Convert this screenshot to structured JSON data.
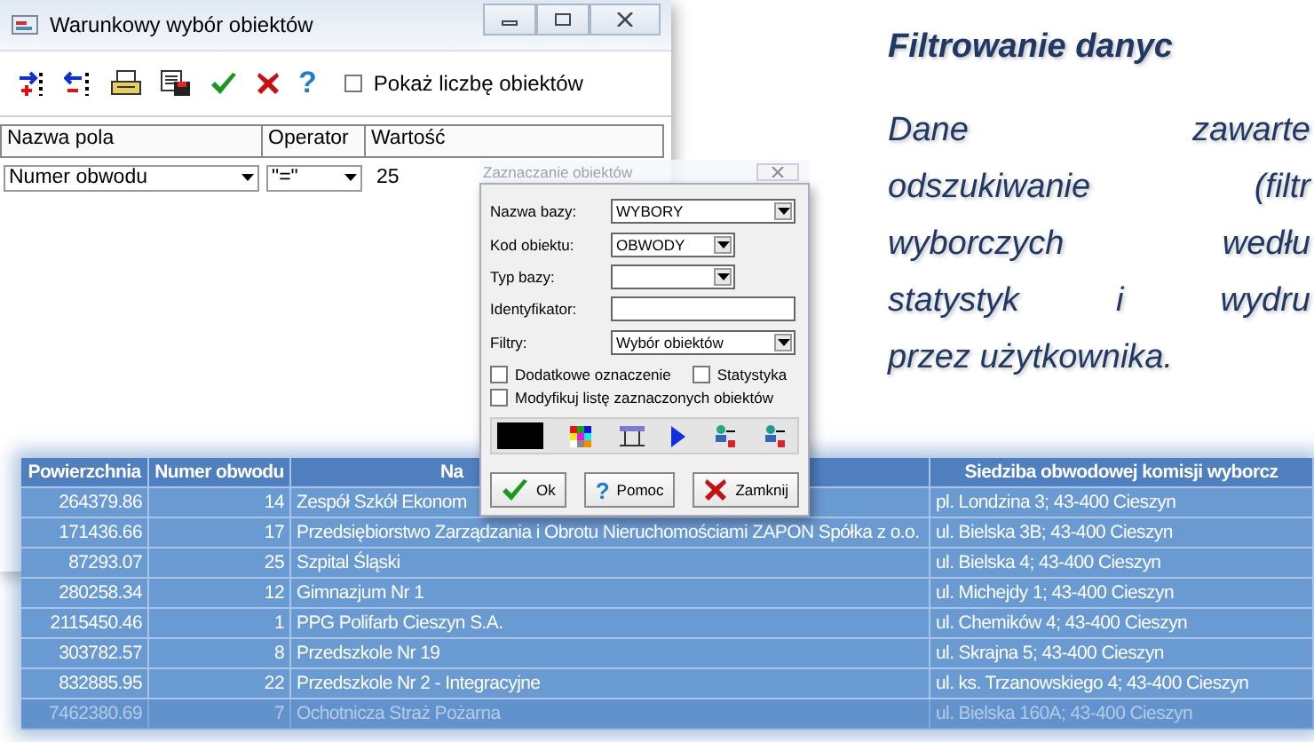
{
  "filter_window": {
    "title": "Warunkowy wybór obiektów",
    "help_glyph": "?",
    "show_count": {
      "label": "Pokaż liczbę obiektów",
      "checked": false
    },
    "columns": [
      "Nazwa pola",
      "Operator",
      "Wartość"
    ],
    "condition": {
      "field": "Numer obwodu",
      "operator": "\"=\"",
      "value": "25"
    }
  },
  "select_dialog": {
    "title": "Zaznaczanie obiektów",
    "fields": [
      {
        "label": "Nazwa bazy:",
        "kind": "select",
        "value": "WYBORY"
      },
      {
        "label": "Kod obiektu:",
        "kind": "select",
        "value": "OBWODY"
      },
      {
        "label": "Typ bazy:",
        "kind": "select"
      },
      {
        "label": "Identyfikator:",
        "kind": "input"
      },
      {
        "label": "Filtry:",
        "kind": "select",
        "value": "Wybór obiektów"
      }
    ],
    "checkboxes": [
      {
        "label": "Dodatkowe oznaczenie",
        "checked": false
      },
      {
        "label": "Statystyka",
        "checked": false
      },
      {
        "label": "Modyfikuj listę zaznaczonych obiektów",
        "checked": false
      }
    ],
    "buttons": [
      {
        "label": "Ok",
        "kind": "ok"
      },
      {
        "label": "Pomoc",
        "kind": "help",
        "glyph": "?"
      },
      {
        "label": "Zamknij",
        "kind": "close"
      }
    ]
  },
  "results_table": {
    "columns": [
      "Powierzchnia",
      "Numer obwodu",
      "Na",
      "Siedziba obwodowej komisji wyborcz"
    ],
    "rows": [
      [
        "264379.86",
        "14",
        "Zespół Szkół Ekonom",
        "pl. Londzina 3; 43-400 Cieszyn"
      ],
      [
        "171436.66",
        "17",
        "Przedsiębiorstwo Zarządzania i Obrotu Nieruchomościami ZAPON Spółka z o.o.",
        "ul. Bielska 3B; 43-400 Cieszyn"
      ],
      [
        "87293.07",
        "25",
        "Szpital Śląski",
        "ul. Bielska 4; 43-400 Cieszyn"
      ],
      [
        "280258.34",
        "12",
        "Gimnazjum Nr 1",
        "ul. Michejdy 1; 43-400 Cieszyn"
      ],
      [
        "2115450.46",
        "1",
        "PPG Polifarb Cieszyn S.A.",
        "ul. Chemików 4; 43-400 Cieszyn"
      ],
      [
        "303782.57",
        "8",
        "Przedszkole Nr 19",
        "ul. Skrajna 5; 43-400 Cieszyn"
      ],
      [
        "832885.95",
        "22",
        "Przedszkole Nr 2 - Integracyjne",
        "ul. ks. Trzanowskiego 4; 43-400 Cieszyn"
      ],
      [
        "7462380.69",
        "7",
        "Ochotnicza Straż Pożarna",
        "ul. Bielska 160A; 43-400 Cieszyn"
      ]
    ]
  },
  "slide": {
    "title": "Filtrowanie danyc",
    "lines": [
      "Dane zawarte",
      "odszukiwanie (filtr",
      "wyborczych wedłu",
      "statystyk i wydru",
      "przez użytkownika."
    ]
  }
}
